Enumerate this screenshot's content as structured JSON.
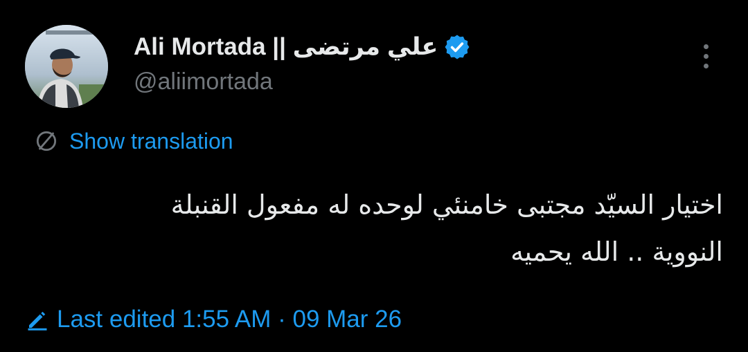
{
  "author": {
    "display_name": "Ali Mortada || علي مرتضى",
    "handle": "@aliimortada",
    "verified_color": "#1d9bf0",
    "avatar_icon": "profile-photo"
  },
  "menu": {
    "more_icon": "vertical-ellipsis-icon"
  },
  "translation": {
    "label": "Show translation",
    "icon": "translate-globe-icon"
  },
  "tweet": {
    "text": "اختيار السيّد مجتبى خامنئي لوحده له مفعول القنبلة النووية .. الله يحميه"
  },
  "edit_info": {
    "label": "Last edited 1:55 AM · 09 Mar 26",
    "icon": "pencil-icon"
  },
  "colors": {
    "background": "#000000",
    "text_primary": "#e7e9ea",
    "text_secondary": "#71767b",
    "accent": "#1d9bf0"
  }
}
